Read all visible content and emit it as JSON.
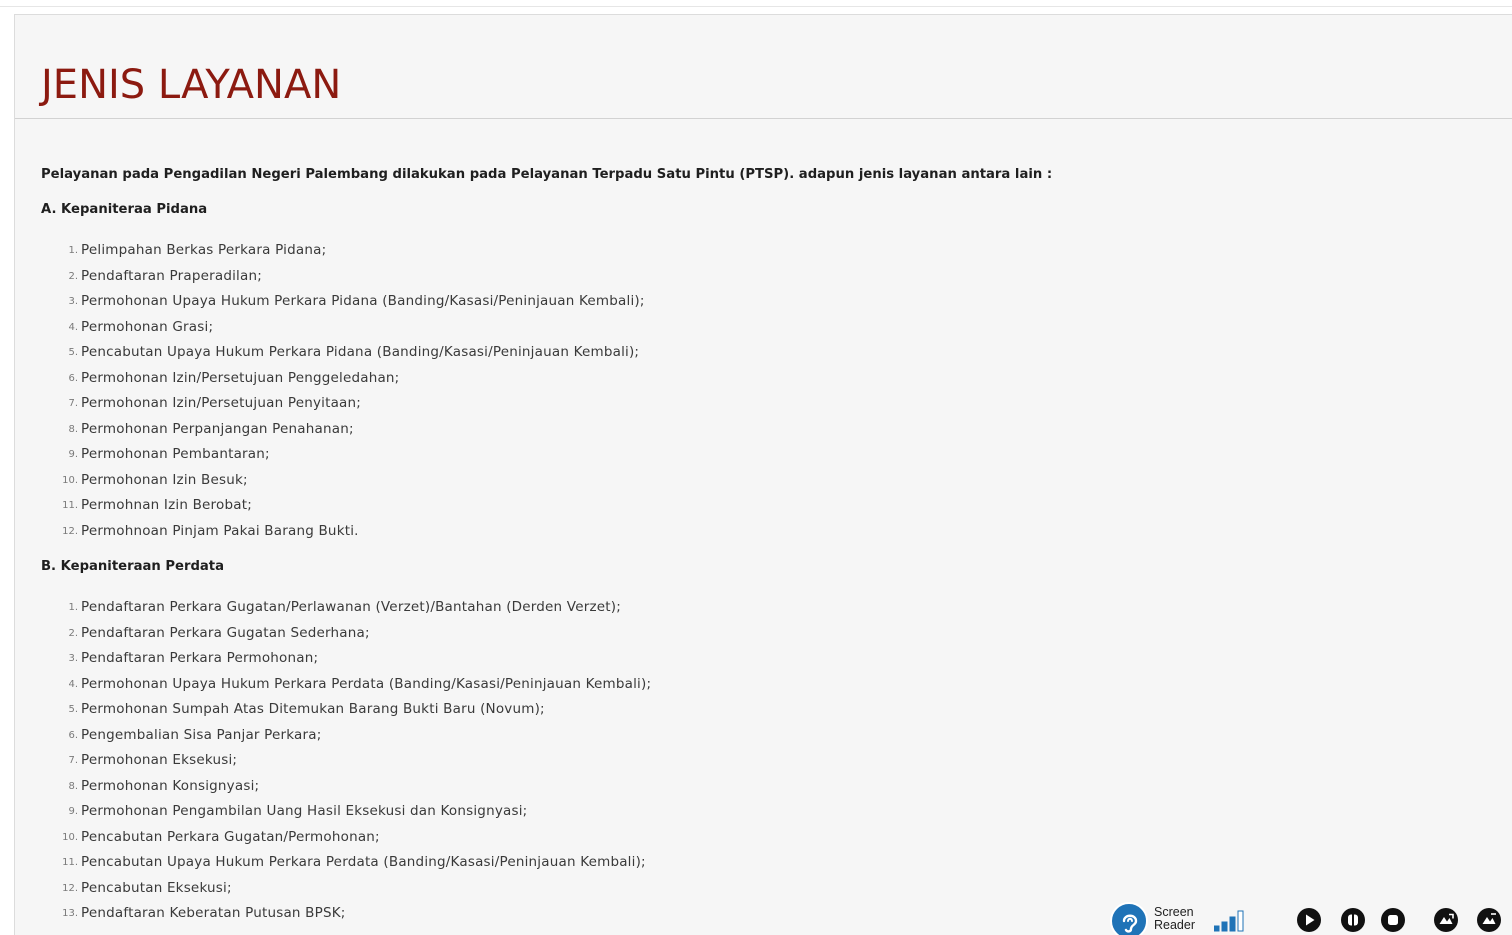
{
  "page": {
    "title": "JENIS LAYANAN",
    "intro": "Pelayanan pada Pengadilan Negeri Palembang dilakukan pada Pelayanan Terpadu Satu Pintu (PTSP). adapun jenis layanan antara lain :"
  },
  "sections": [
    {
      "heading": "A. Kepaniteraa Pidana",
      "items": [
        {
          "num": "1.",
          "text": "Pelimpahan Berkas Perkara Pidana;"
        },
        {
          "num": "2.",
          "text": "Pendaftaran Praperadilan;"
        },
        {
          "num": "3.",
          "text": "Permohonan Upaya Hukum Perkara Pidana (Banding/Kasasi/Peninjauan Kembali);"
        },
        {
          "num": "4.",
          "text": "Permohonan Grasi;"
        },
        {
          "num": "5.",
          "text": "Pencabutan Upaya Hukum Perkara Pidana (Banding/Kasasi/Peninjauan Kembali);"
        },
        {
          "num": "6.",
          "text": "Permohonan Izin/Persetujuan Penggeledahan;"
        },
        {
          "num": "7.",
          "text": "Permohonan Izin/Persetujuan Penyitaan;"
        },
        {
          "num": "8.",
          "text": "Permohonan Perpanjangan Penahanan;"
        },
        {
          "num": "9.",
          "text": "Permohonan Pembantaran;"
        },
        {
          "num": "10.",
          "text": "Permohonan Izin Besuk;"
        },
        {
          "num": "11.",
          "text": "Permohnan Izin Berobat;"
        },
        {
          "num": "12.",
          "text": "Permohnoan Pinjam Pakai Barang Bukti."
        }
      ]
    },
    {
      "heading": "B. Kepaniteraan Perdata",
      "items": [
        {
          "num": "1.",
          "text": "Pendaftaran Perkara Gugatan/Perlawanan (Verzet)/Bantahan (Derden Verzet);"
        },
        {
          "num": "2.",
          "text": "Pendaftaran Perkara Gugatan Sederhana;"
        },
        {
          "num": "3.",
          "text": "Pendaftaran Perkara Permohonan;"
        },
        {
          "num": "4.",
          "text": "Permohonan Upaya Hukum Perkara Perdata (Banding/Kasasi/Peninjauan Kembali);"
        },
        {
          "num": "5.",
          "text": "Permohonan Sumpah Atas Ditemukan Barang Bukti Baru (Novum);"
        },
        {
          "num": "6.",
          "text": "Pengembalian Sisa Panjar Perkara;"
        },
        {
          "num": "7.",
          "text": "Permohonan Eksekusi;"
        },
        {
          "num": "8.",
          "text": "Permohonan Konsignyasi;"
        },
        {
          "num": "9.",
          "text": "Permohonan Pengambilan Uang Hasil Eksekusi dan Konsignyasi;"
        },
        {
          "num": "10.",
          "text": "Pencabutan Perkara Gugatan/Permohonan;"
        },
        {
          "num": "11.",
          "text": "Pencabutan Upaya Hukum Perkara Perdata (Banding/Kasasi/Peninjauan Kembali);"
        },
        {
          "num": "12.",
          "text": "Pencabutan Eksekusi;"
        },
        {
          "num": "13.",
          "text": "Pendaftaran Keberatan Putusan BPSK;"
        }
      ]
    }
  ],
  "screen_reader": {
    "label_line1": "Screen",
    "label_line2": "Reader",
    "logo_icon": "ear-icon",
    "volume_level": 0.75,
    "buttons": [
      "play-icon",
      "pause-icon",
      "stop-icon",
      "speed-up-icon",
      "speed-down-icon"
    ]
  },
  "colors": {
    "title": "#8c1a10",
    "panel_bg": "#f6f6f6",
    "text": "#3a3a3a",
    "reader_blue": "#1f73b7"
  }
}
